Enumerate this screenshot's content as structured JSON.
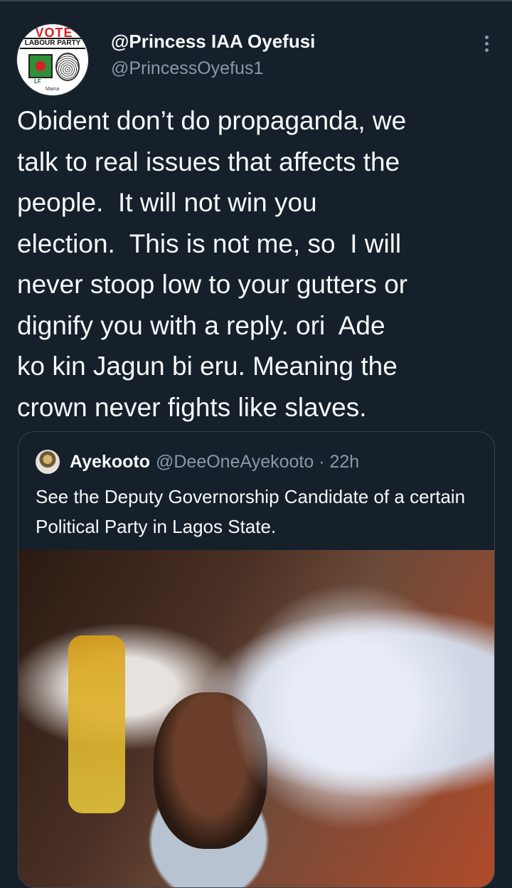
{
  "tweet": {
    "avatar": {
      "vote_text": "VOTE",
      "party_text": "LABOUR PARTY",
      "logo_text": "LF",
      "caption": "Mama"
    },
    "display_name": "@Princess IAA Oyefusi",
    "handle": "@PrincessOyefus1",
    "more_icon": "more-vertical-icon",
    "text": "Obident don’t do propaganda, we\ntalk to real issues that affects the\npeople.  It will not win you\nelection.  This is not me, so  I will\nnever stoop low to your gutters or\ndignify you with a reply. ori  Ade\nko kin Jagun bi eru. Meaning the\ncrown never fights like slaves.",
    "quoted": {
      "avatar_icon": "avatar-icon",
      "display_name": "Ayekooto",
      "meta": "@DeeOneAyekooto · 22h",
      "text": "See the Deputy Governorship Candidate of a certain Political Party in Lagos State.",
      "media": "photo"
    }
  },
  "colors": {
    "background": "#15202b",
    "text": "#f7f9f9",
    "secondary": "#8b98a5",
    "border": "#38444d"
  }
}
